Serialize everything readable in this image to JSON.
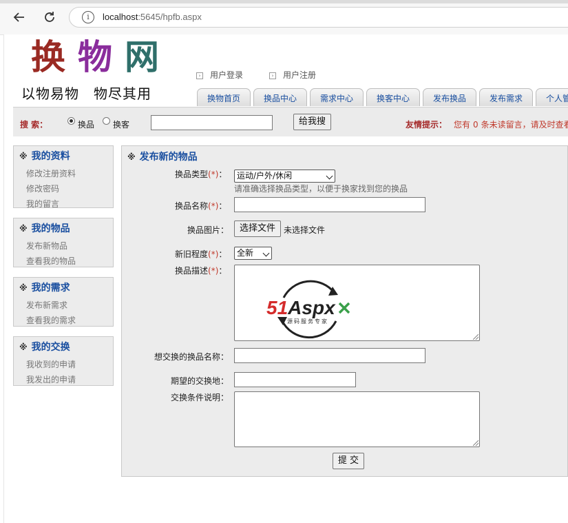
{
  "browser": {
    "back_icon": "back-arrow-icon",
    "reload_icon": "reload-icon",
    "info_icon": "info-icon",
    "url_host": "localhost",
    "url_path": ":5645/hpfb.aspx"
  },
  "header": {
    "logo_chars": [
      "换",
      "物",
      "网"
    ],
    "logo_colors": [
      "#9a2a23",
      "#8a2d9c",
      "#2f6f6a"
    ],
    "slogan": "以物易物　物尽其用",
    "links": [
      "用户登录",
      "用户注册"
    ]
  },
  "nav": {
    "tabs": [
      "换物首页",
      "换品中心",
      "需求中心",
      "换客中心",
      "发布换品",
      "发布需求",
      "个人管"
    ]
  },
  "search": {
    "label": "搜 索：",
    "options": [
      "换品",
      "换客"
    ],
    "selected": "换品",
    "button": "给我搜",
    "tip_label": "友情提示：",
    "tip_prefix": "您有",
    "tip_count": "0",
    "tip_suffix": "条未读留言，请及时查看"
  },
  "sidebar": [
    {
      "title": "我的资料",
      "items": [
        "修改注册资料",
        "修改密码",
        "我的留言"
      ]
    },
    {
      "title": "我的物品",
      "items": [
        "发布新物品",
        "查看我的物品"
      ]
    },
    {
      "title": "我的需求",
      "items": [
        "发布新需求",
        "查看我的需求"
      ]
    },
    {
      "title": "我的交换",
      "items": [
        "我收到的申请",
        "我发出的申请"
      ]
    }
  ],
  "sidebar_mark": "※",
  "form": {
    "title": "发布新的物品",
    "type_label": "换品类型",
    "type_value": "运动/户外/休闲",
    "type_hint": "请准确选择换品类型，以便于换家找到您的换品",
    "name_label": "换品名称",
    "image_label": "换品图片：",
    "file_button": "选择文件",
    "file_status": "未选择文件",
    "condition_label": "新旧程度",
    "condition_value": "全新",
    "desc_label": "换品描述",
    "want_label": "想交换的换品名称：",
    "place_label": "期望的交换地：",
    "terms_label": "交换条件说明：",
    "submit": "提 交",
    "req_mark": "(*)",
    "colon": "："
  },
  "watermark": {
    "brand_5": "5",
    "brand_1": "1",
    "brand_a": "A",
    "brand_spx": "spx",
    "tagline": "源码服务专家",
    "colors": {
      "red": "#d42b2b",
      "green": "#3aa04a",
      "dark": "#222222"
    }
  }
}
